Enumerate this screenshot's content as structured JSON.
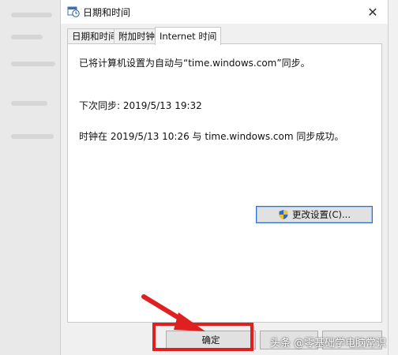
{
  "window": {
    "title": "日期和时间"
  },
  "tabs": [
    {
      "label": "日期和时间",
      "active": false
    },
    {
      "label": "附加时钟",
      "active": false
    },
    {
      "label": "Internet 时间",
      "active": true
    }
  ],
  "panel": {
    "sync_setting": "已将计算机设置为自动与“time.windows.com”同步。",
    "next_sync": "下次同步: 2019/5/13 19:32",
    "last_sync_result": "时钟在 2019/5/13 10:26 与 time.windows.com 同步成功。",
    "change_settings_label": "更改设置(C)..."
  },
  "buttons": {
    "ok_label": "确定"
  },
  "watermark": {
    "text": "头条 @零基础学电脑常识"
  },
  "colors": {
    "annotation": "#e02020",
    "focus_border": "#2f6fd0"
  }
}
